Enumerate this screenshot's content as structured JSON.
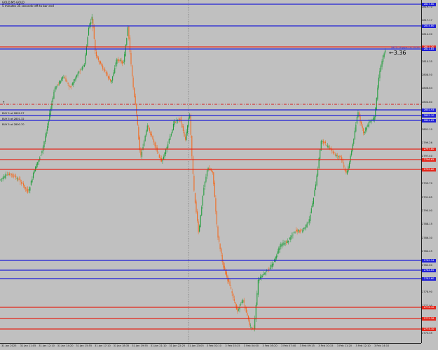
{
  "header": {
    "symbol_line": "GOLD,M5  GOLD",
    "timer_line": "5 minutes 35 seconds left to bar end"
  },
  "spread_label": "3.36",
  "bid_note": "2872.19 pips 14:13:29",
  "price_levels": [
    {
      "kind": "blue",
      "label": "2817.60"
    },
    {
      "kind": "blue",
      "label": "2814.80"
    },
    {
      "kind": "red",
      "label": "2812.20"
    },
    {
      "kind": "blue",
      "label": "2811.85"
    },
    {
      "kind": "blue",
      "label": "2802.93"
    },
    {
      "kind": "blue",
      "label": "2802.10"
    },
    {
      "kind": "blue",
      "label": "2801.65"
    },
    {
      "kind": "red",
      "label": "2797.80"
    },
    {
      "kind": "red",
      "label": "2796.65"
    },
    {
      "kind": "red",
      "label": "2795.60"
    },
    {
      "kind": "blue",
      "label": "2785.54"
    },
    {
      "kind": "blue",
      "label": "2784.65"
    },
    {
      "kind": "blue",
      "label": "2783.60"
    },
    {
      "kind": "red",
      "label": "2776.10"
    },
    {
      "kind": "red",
      "label": "2775.28"
    },
    {
      "kind": "red",
      "label": "2774.10"
    }
  ],
  "price_axis": [
    "2819.70",
    "2817.17",
    "2814.00",
    "2812.20",
    "2810.35",
    "2808.50",
    "2806.63",
    "2804.80",
    "2802.95",
    "2801.10",
    "2799.26",
    "2797.40",
    "2795.56",
    "2793.70",
    "2791.85",
    "2790.00",
    "2788.15",
    "2786.30",
    "2784.45",
    "2782.60",
    "2780.75",
    "2778.90",
    "2777.05",
    "2775.20",
    "2773.35"
  ],
  "order_labels": [
    "BUY 5 at 2802.27",
    "BUY 5 at 2801.32",
    "BUY 5 at 2800.70"
  ],
  "time_axis": [
    "31 Jan 2025",
    "31 Jan 11:05",
    "31 Jan 12:10",
    "31 Jan 14:20",
    "31 Jan 15:55",
    "31 Jan 17:10",
    "31 Jan 18:35",
    "31 Jan 19:55",
    "31 Jan 21:10",
    "31 Jan 22:25",
    "31 Jan 23:05",
    "3 Feb 02:10",
    "3 Feb 03:15",
    "3 Feb 04:00",
    "3 Feb 05:20",
    "3 Feb 07:40",
    "3 Feb 09:15",
    "3 Feb 10:15",
    "3 Feb 11:20",
    "3 Feb 12:10",
    "3 Feb 14:10"
  ],
  "colors": {
    "background": "#c0c0c0",
    "bull": "#1f9d3a",
    "bear": "#f26a1f",
    "level_blue": "#1f1fd6",
    "level_red": "#e3261a",
    "signal": "#d81b1b"
  },
  "icons": {
    "trade_marker": "trade-arrow-icon",
    "bid_pointer": "bid-pointer-icon"
  }
}
